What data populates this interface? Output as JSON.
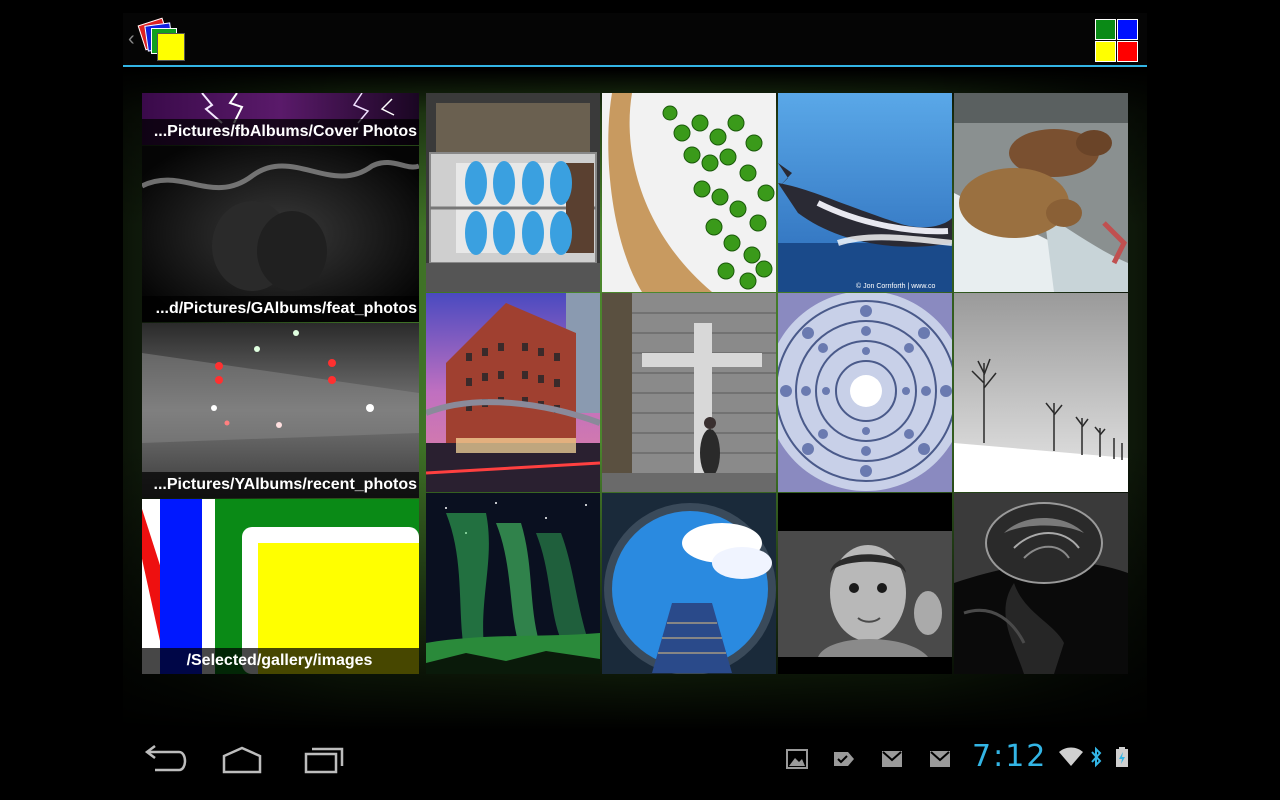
{
  "action_bar": {
    "up_caret": "‹",
    "logo_icon": "gallery-stacked-squares-icon",
    "color_squares": [
      "#0a8a16",
      "#0010ff",
      "#ffff00",
      "#ff0000"
    ],
    "accent": "#33b5e5"
  },
  "albums": [
    {
      "caption": "...Pictures/fbAlbums/Cover Photos",
      "thumb": "lightning-storm"
    },
    {
      "caption": "...d/Pictures/GAlbums/feat_photos",
      "thumb": "dark-portrait",
      "selected": true
    },
    {
      "caption": "...Pictures/YAlbums/recent_photos",
      "thumb": "foggy-street-lights"
    },
    {
      "caption": "/Selected/gallery/images",
      "thumb": "color-blocks"
    }
  ],
  "photos": [
    {
      "subject": "gloved-hands"
    },
    {
      "subject": "green-peppercorns"
    },
    {
      "subject": "breaching-whale",
      "watermark": "© Jon Cornforth | www.co"
    },
    {
      "subject": "grizzly-bears"
    },
    {
      "subject": "brick-hotel-building"
    },
    {
      "subject": "brick-wall-pedestrian"
    },
    {
      "subject": "dome-ceiling"
    },
    {
      "subject": "snow-trees"
    },
    {
      "subject": "aurora"
    },
    {
      "subject": "fisheye-sky-tower"
    },
    {
      "subject": "boy-portrait"
    },
    {
      "subject": "rose-bw"
    }
  ],
  "navbar": {
    "buttons": [
      "back-icon",
      "home-icon",
      "recent-apps-icon"
    ],
    "notifications": [
      "picture-icon",
      "tag-icon",
      "gmail-icon",
      "gmail-icon"
    ],
    "clock": "7:12",
    "status": [
      "wifi-icon",
      "bluetooth-icon",
      "battery-charging-icon"
    ]
  }
}
